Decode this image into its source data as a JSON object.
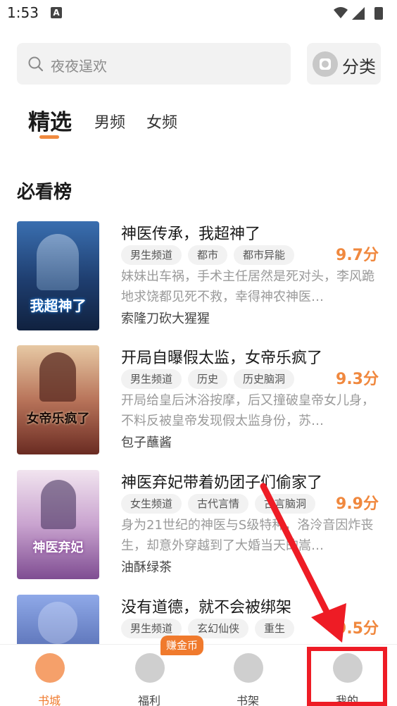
{
  "status_bar": {
    "time": "1:53",
    "notification_badge": "A"
  },
  "search": {
    "placeholder": "夜夜逞欢"
  },
  "category_button": {
    "label": "分类"
  },
  "tabs": [
    {
      "label": "精选",
      "active": true
    },
    {
      "label": "男频",
      "active": false
    },
    {
      "label": "女频",
      "active": false
    }
  ],
  "section": {
    "title": "必看榜"
  },
  "books": [
    {
      "title": "神医传承，我超神了",
      "tags": [
        "男生频道",
        "都市",
        "都市异能"
      ],
      "score": "9.7分",
      "description": "妹妹出车祸，手术主任居然是死对头，李风跪地求饶都见死不救，幸得神农神医…",
      "author": "索隆刀砍大猩猩",
      "cover_text": "我超神了",
      "cover_colors": [
        "#1e3d6e",
        "#3a6fb0"
      ]
    },
    {
      "title": "开局自曝假太监，女帝乐疯了",
      "tags": [
        "男生频道",
        "历史",
        "历史脑洞"
      ],
      "score": "9.3分",
      "description": "开局给皇后沐浴按摩，后又撞破皇帝女儿身，不料反被皇帝发现假太监身份，苏…",
      "author": "包子蘸酱",
      "cover_text": "女帝乐疯了",
      "cover_colors": [
        "#d9b08a",
        "#7a3b2a"
      ]
    },
    {
      "title": "神医弃妃带着奶团子们偷家了",
      "tags": [
        "女生频道",
        "古代言情",
        "古言脑洞"
      ],
      "score": "9.9分",
      "description": "身为21世纪的神医与S级特种，洛泠音因炸丧生，却意外穿越到了大婚当天的嵩…",
      "author": "油酥绿茶",
      "cover_text": "神医弃妃",
      "cover_colors": [
        "#e8d3e6",
        "#9a6aa8"
      ]
    },
    {
      "title": "没有道德，就不会被绑架",
      "tags": [
        "男生频道",
        "玄幻仙侠",
        "重生"
      ],
      "score": "9.5分",
      "description": "",
      "author": "",
      "cover_text": "",
      "cover_colors": [
        "#2a3f8a",
        "#8fa9e8"
      ]
    }
  ],
  "bottom_nav": [
    {
      "label": "书城",
      "active": true,
      "icon": "bookstore-icon"
    },
    {
      "label": "福利",
      "active": false,
      "icon": "gift-icon"
    },
    {
      "label": "书架",
      "active": false,
      "icon": "bookshelf-icon"
    },
    {
      "label": "我的",
      "active": false,
      "icon": "profile-icon"
    }
  ],
  "earn_badge": "赚金币",
  "colors": {
    "accent": "#f07a2d",
    "score": "#f0883e",
    "annotation": "#ee1c25"
  }
}
